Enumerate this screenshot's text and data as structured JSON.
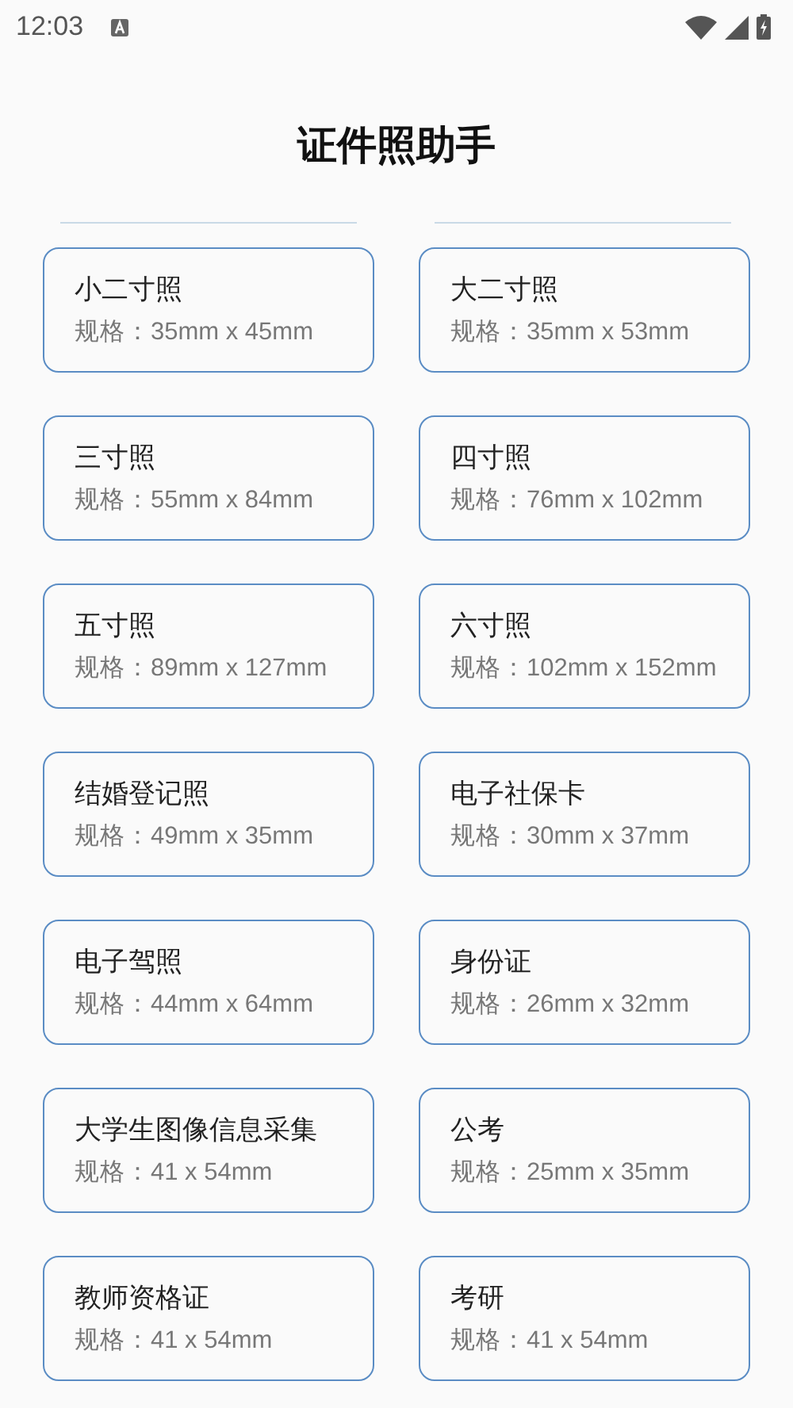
{
  "status_bar": {
    "time": "12:03"
  },
  "title": "证件照助手",
  "cards": [
    {
      "name": "小二寸照",
      "spec": "规格：35mm x 45mm"
    },
    {
      "name": "大二寸照",
      "spec": "规格：35mm x 53mm"
    },
    {
      "name": "三寸照",
      "spec": "规格：55mm x 84mm"
    },
    {
      "name": "四寸照",
      "spec": "规格：76mm x 102mm"
    },
    {
      "name": "五寸照",
      "spec": "规格：89mm x 127mm"
    },
    {
      "name": "六寸照",
      "spec": "规格：102mm x 152mm"
    },
    {
      "name": "结婚登记照",
      "spec": "规格：49mm x 35mm"
    },
    {
      "name": "电子社保卡",
      "spec": "规格：30mm x 37mm"
    },
    {
      "name": "电子驾照",
      "spec": "规格：44mm x 64mm"
    },
    {
      "name": "身份证",
      "spec": "规格：26mm x 32mm"
    },
    {
      "name": "大学生图像信息采集",
      "spec": "规格：41 x 54mm"
    },
    {
      "name": "公考",
      "spec": "规格：25mm x 35mm"
    },
    {
      "name": "教师资格证",
      "spec": "规格：41 x 54mm"
    },
    {
      "name": "考研",
      "spec": "规格：41 x 54mm"
    }
  ]
}
